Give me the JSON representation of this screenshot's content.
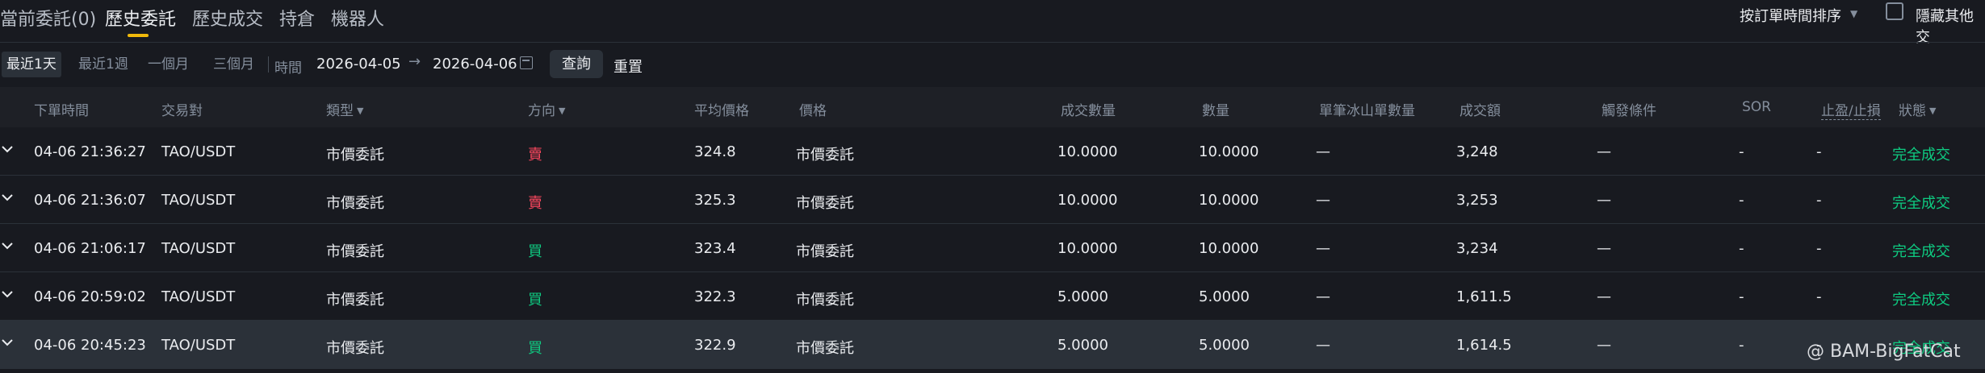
{
  "tabs": [
    {
      "label": "當前委託(0)"
    },
    {
      "label": "歷史委託"
    },
    {
      "label": "歷史成交"
    },
    {
      "label": "持倉"
    },
    {
      "label": "機器人"
    }
  ],
  "sort": {
    "label": "按訂單時間排序"
  },
  "hide_others": {
    "label": "隱藏其他交"
  },
  "filters": {
    "ranges": [
      "最近1天",
      "最近1週",
      "一個月",
      "三個月"
    ],
    "time_label": "時間",
    "start_date": "2026-04-05",
    "arrow": "→",
    "end_date": "2026-04-06",
    "query": "查詢",
    "reset": "重置"
  },
  "columns": {
    "time": "下單時間",
    "pair": "交易對",
    "type": "類型",
    "side": "方向",
    "avg_price": "平均價格",
    "price": "價格",
    "filled": "成交數量",
    "amount": "數量",
    "iceberg": "單筆冰山單數量",
    "total": "成交額",
    "trigger": "觸發條件",
    "sor": "SOR",
    "tpsl": "止盈/止損",
    "status": "狀態"
  },
  "rows": [
    {
      "time": "04-06 21:36:27",
      "pair": "TAO/USDT",
      "type": "市價委託",
      "side": "賣",
      "side_kind": "sell",
      "avg_price": "324.8",
      "price": "市價委託",
      "filled": "10.0000",
      "amount": "10.0000",
      "iceberg": "—",
      "total": "3,248",
      "trigger": "—",
      "sor": "-",
      "tpsl": "-",
      "status": "完全成交"
    },
    {
      "time": "04-06 21:36:07",
      "pair": "TAO/USDT",
      "type": "市價委託",
      "side": "賣",
      "side_kind": "sell",
      "avg_price": "325.3",
      "price": "市價委託",
      "filled": "10.0000",
      "amount": "10.0000",
      "iceberg": "—",
      "total": "3,253",
      "trigger": "—",
      "sor": "-",
      "tpsl": "-",
      "status": "完全成交"
    },
    {
      "time": "04-06 21:06:17",
      "pair": "TAO/USDT",
      "type": "市價委託",
      "side": "買",
      "side_kind": "buy",
      "avg_price": "323.4",
      "price": "市價委託",
      "filled": "10.0000",
      "amount": "10.0000",
      "iceberg": "—",
      "total": "3,234",
      "trigger": "—",
      "sor": "-",
      "tpsl": "-",
      "status": "完全成交"
    },
    {
      "time": "04-06 20:59:02",
      "pair": "TAO/USDT",
      "type": "市價委託",
      "side": "買",
      "side_kind": "buy",
      "avg_price": "322.3",
      "price": "市價委託",
      "filled": "5.0000",
      "amount": "5.0000",
      "iceberg": "—",
      "total": "1,611.5",
      "trigger": "—",
      "sor": "-",
      "tpsl": "-",
      "status": "完全成交"
    },
    {
      "time": "04-06 20:45:23",
      "pair": "TAO/USDT",
      "type": "市價委託",
      "side": "買",
      "side_kind": "buy",
      "avg_price": "322.9",
      "price": "市價委託",
      "filled": "5.0000",
      "amount": "5.0000",
      "iceberg": "—",
      "total": "1,614.5",
      "trigger": "—",
      "sor": "-",
      "tpsl": "-",
      "status": "完全成交"
    }
  ],
  "watermark": "@ BAM-BigFatCat",
  "colors": {
    "sell": "#f6465d",
    "buy": "#0ecb81",
    "accent": "#f0b90b",
    "background": "#181a20"
  }
}
